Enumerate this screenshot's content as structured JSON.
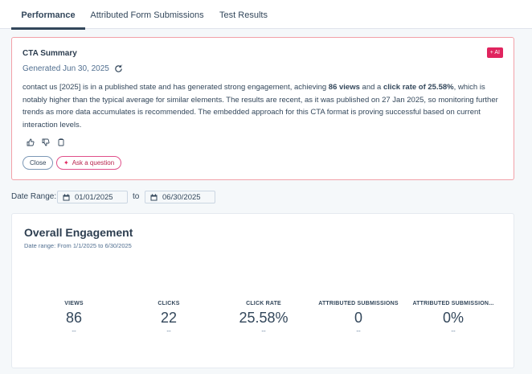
{
  "tabs": [
    {
      "label": "Performance",
      "active": true
    },
    {
      "label": "Attributed Form Submissions",
      "active": false
    },
    {
      "label": "Test Results",
      "active": false
    }
  ],
  "summary": {
    "title": "CTA Summary",
    "ai_badge": "+ AI",
    "generated": "Generated Jun 30, 2025",
    "text_parts": {
      "p1": "contact us [2025] is in a published state and has generated strong engagement, achieving ",
      "b1": "86 views",
      "p2": " and a ",
      "b2": "click rate of 25.58%",
      "p3": ", which is notably higher than the typical average for similar elements. The results are recent, as it was published on 27 Jan 2025, so monitoring further trends as more data accumulates is recommended. The embedded approach for this CTA format is proving successful based on current interaction levels."
    },
    "close_label": "Close",
    "ask_label": "Ask a question"
  },
  "date_range": {
    "label": "Date Range:",
    "from": "01/01/2025",
    "to_label": "to",
    "to": "06/30/2025"
  },
  "engagement": {
    "title": "Overall Engagement",
    "subtitle": "Date range: From 1/1/2025 to 6/30/2025",
    "metrics": [
      {
        "label": "VIEWS",
        "value": "86",
        "change": "--"
      },
      {
        "label": "CLICKS",
        "value": "22",
        "change": "--"
      },
      {
        "label": "CLICK RATE",
        "value": "25.58%",
        "change": "--"
      },
      {
        "label": "ATTRIBUTED SUBMISSIONS",
        "value": "0",
        "change": "--"
      },
      {
        "label": "ATTRIBUTED SUBMISSION...",
        "value": "0%",
        "change": "--"
      }
    ]
  },
  "colors": {
    "accent_pink": "#e0245e",
    "text_dark": "#33475b",
    "summary_border": "#f2a1a8"
  }
}
